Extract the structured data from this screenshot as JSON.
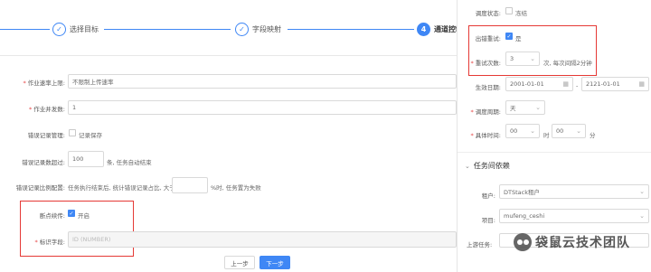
{
  "steps": [
    {
      "label": "选择目标",
      "icon": "check-icon",
      "glyph": "✓"
    },
    {
      "label": "字段映射",
      "icon": "check-icon",
      "glyph": "✓"
    },
    {
      "label": "通道控制",
      "number": "4"
    }
  ],
  "form": {
    "speed_label": "作业速率上限:",
    "speed_value": "不限制上传速率",
    "concurrency_label": "作业并发数:",
    "concurrency_value": "1",
    "error_mgmt_label": "错误记录管理:",
    "error_mgmt_option": "记录保存",
    "error_count_label": "错误记录数超过:",
    "error_count_value": "100",
    "error_count_suffix": "条, 任务自动结束",
    "error_ratio_label": "错误记录比例配置:",
    "error_ratio_prefix": "任务执行结束后, 统计错误记录占比, 大于",
    "error_ratio_suffix": "%时, 任务置为失败",
    "resume_label": "断点续传:",
    "resume_option": "开启",
    "resume_checked": true,
    "mark_field_label": "标识字段:",
    "mark_field_placeholder": "ID (NUMBER)",
    "prev_button": "上一步",
    "next_button": "下一步"
  },
  "right_panel": {
    "schedule_status_label": "调度状态:",
    "schedule_status_option": "冻结",
    "retry_label": "出错重试:",
    "retry_option": "是",
    "retry_checked": true,
    "retry_count_label": "重试次数:",
    "retry_count_value": "3",
    "retry_count_suffix": "次, 每次间隔2分钟",
    "effective_date_label": "生效日期:",
    "start_date": "2001-01-01",
    "date_separator": "-",
    "end_date": "2121-01-01",
    "cycle_label": "调度周期:",
    "cycle_value": "天",
    "time_label": "具体时间:",
    "hour_value": "00",
    "hour_unit": "时",
    "minute_value": "00",
    "minute_unit": "分",
    "dependency_section": "任务间依赖",
    "tenant_label": "租户:",
    "tenant_value": "DTStack租户",
    "project_label": "项目:",
    "project_value": "mufeng_ceshi",
    "upstream_label": "上游任务:"
  },
  "watermark": "袋鼠云技术团队",
  "colors": {
    "accent": "#3f87f5",
    "highlight_box": "#e53935",
    "required": "#e64545"
  }
}
